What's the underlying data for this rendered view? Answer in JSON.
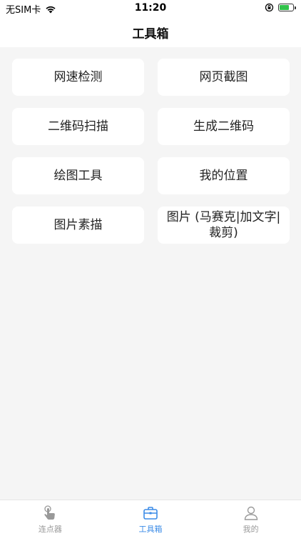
{
  "status_bar": {
    "carrier": "无SIM卡",
    "time": "11:20"
  },
  "nav": {
    "title": "工具箱"
  },
  "tools": [
    {
      "label": "网速检测"
    },
    {
      "label": "网页截图"
    },
    {
      "label": "二维码扫描"
    },
    {
      "label": "生成二维码"
    },
    {
      "label": "绘图工具"
    },
    {
      "label": "我的位置"
    },
    {
      "label": "图片素描"
    },
    {
      "label": "图片 (马赛克|加文字|裁剪)"
    }
  ],
  "tab_bar": {
    "items": [
      {
        "label": "连点器",
        "icon": "tap-hand-icon",
        "active": false
      },
      {
        "label": "工具箱",
        "icon": "toolbox-icon",
        "active": true
      },
      {
        "label": "我的",
        "icon": "person-icon",
        "active": false
      }
    ]
  },
  "colors": {
    "accent": "#3c8ce7",
    "inactive": "#999999",
    "background": "#f5f5f5",
    "card": "#ffffff",
    "battery": "#31c24a"
  },
  "battery_level": 0.75
}
